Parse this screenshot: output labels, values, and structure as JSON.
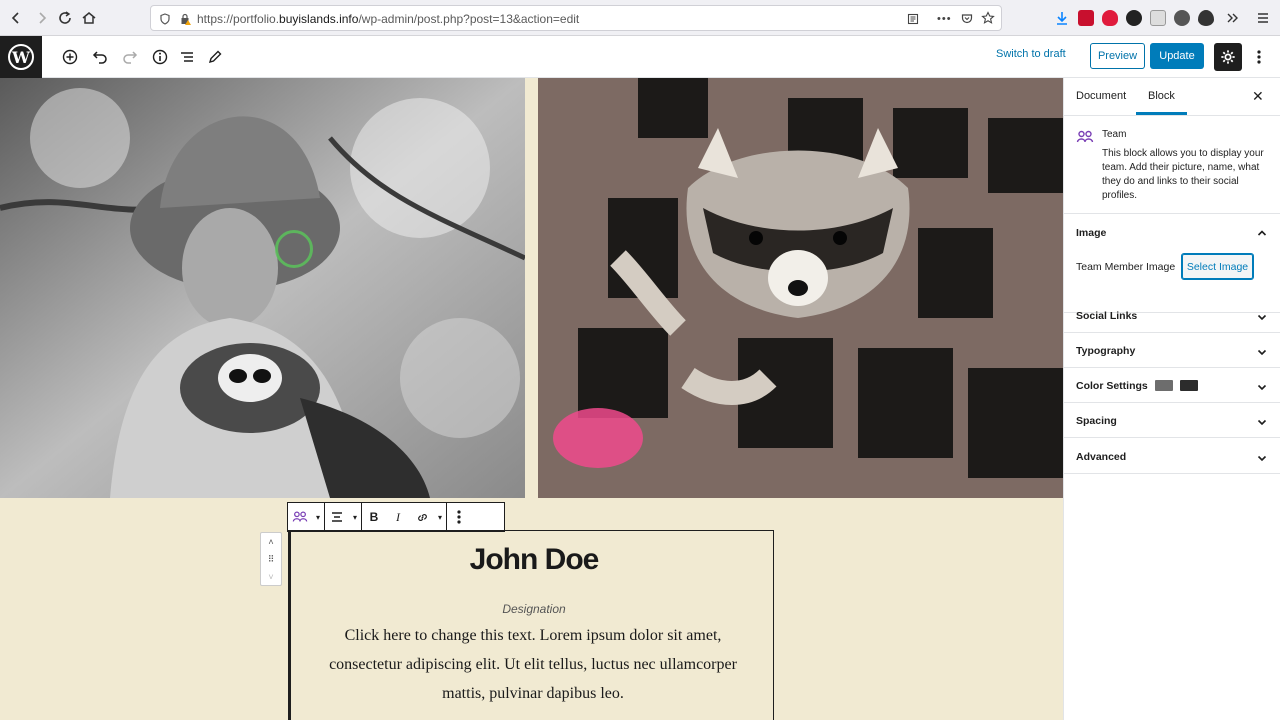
{
  "browser": {
    "url_prefix": "https://portfolio.",
    "url_domain": "buyislands.info",
    "url_path": "/wp-admin/post.php?post=13&action=edit"
  },
  "toolbar": {
    "switch_to_draft": "Switch to draft",
    "preview": "Preview",
    "update": "Update"
  },
  "team_member": {
    "name": "John Doe",
    "designation": "Designation",
    "description": "Click here to change this text. Lorem ipsum dolor sit amet, consectetur adipiscing elit. Ut elit tellus, luctus nec ullamcorper mattis, pulvinar dapibus leo."
  },
  "sidebar": {
    "tabs": [
      "Document",
      "Block"
    ],
    "active_tab": "Block",
    "block_title": "Team",
    "block_description": "This block allows you to display your team. Add their picture, name, what they do and links to their social profiles.",
    "panels": {
      "image": "Image",
      "social_links": "Social Links",
      "typography": "Typography",
      "color_settings": "Color Settings",
      "spacing": "Spacing",
      "advanced": "Advanced"
    },
    "team_member_image_label": "Team Member Image",
    "select_image": "Select Image",
    "color_swatches": [
      "#6d6d6d",
      "#2c2c2c"
    ]
  },
  "colors": {
    "accent": "#007cba",
    "canvas_bg": "#f1ead2"
  }
}
